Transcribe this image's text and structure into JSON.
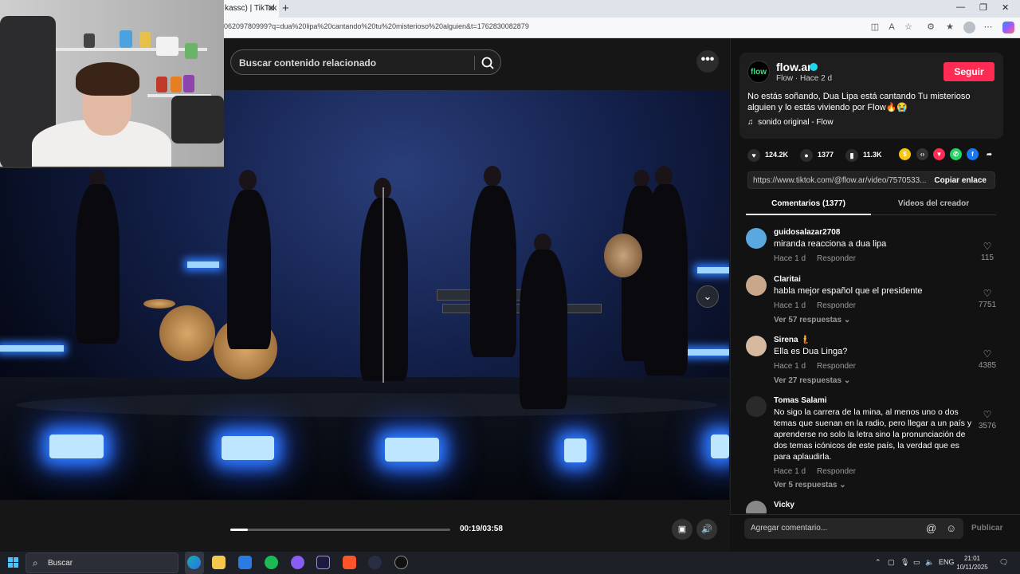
{
  "browser": {
    "tab_title": "kassc) | TikTok",
    "url": "06209780999?q=dua%20lipa%20cantando%20tu%20misterioso%20alguien&t=1762830082879"
  },
  "search": {
    "placeholder": "Buscar contenido relacionado"
  },
  "player": {
    "current_time": "00:19/03:58",
    "progress": 0.08
  },
  "creator": {
    "avatar_text": "flow",
    "name": "flow.ar",
    "subtitle": "Flow · Hace 2 d",
    "follow_label": "Seguir",
    "description": "No estás soñando, Dua Lipa está cantando Tu misterioso alguien y lo estás viviendo por Flow🔥😭",
    "sound": "sonido original - Flow"
  },
  "stats": {
    "likes": "124.2K",
    "comments": "1377",
    "saves": "11.3K"
  },
  "share": {
    "link": "https://www.tiktok.com/@flow.ar/video/7570533...",
    "copy_label": "Copiar enlace"
  },
  "tabs": {
    "comments": "Comentarios (1377)",
    "videos": "Videos del creador"
  },
  "comments": [
    {
      "user": "guidosalazar2708",
      "text": "miranda reacciona a dua lipa",
      "time": "Hace 1 d",
      "reply": "Responder",
      "likes": "115",
      "replies": ""
    },
    {
      "user": "Claritai",
      "text": "habla mejor español que el presidente",
      "time": "Hace 1 d",
      "reply": "Responder",
      "likes": "7751",
      "replies": "Ver 57 respuestas"
    },
    {
      "user": "Sirena 🧜",
      "text": "Ella es Dua Linga?",
      "time": "Hace 1 d",
      "reply": "Responder",
      "likes": "4385",
      "replies": "Ver 27 respuestas"
    },
    {
      "user": "Tomas Salami",
      "text": "No sigo la carrera de la mina, al menos uno o dos temas que suenan en la radio, pero llegar a un país y aprenderse no solo la letra sino la pronunciación de dos temas icónicos de este país, la verdad que es para aplaudirla.",
      "time": "Hace 1 d",
      "reply": "Responder",
      "likes": "3576",
      "replies": "Ver 5 respuestas"
    },
    {
      "user": "Vicky",
      "text": "",
      "time": "",
      "reply": "",
      "likes": "",
      "replies": ""
    }
  ],
  "comment_box": {
    "placeholder": "Agregar comentario...",
    "publish": "Publicar"
  },
  "taskbar": {
    "search": "Buscar",
    "lang": "ENG",
    "time": "21:01",
    "date": "10/11/2025"
  },
  "colors": {
    "accent": "#fe2c55",
    "verified": "#20d5ec",
    "panel_bg": "#121212"
  }
}
